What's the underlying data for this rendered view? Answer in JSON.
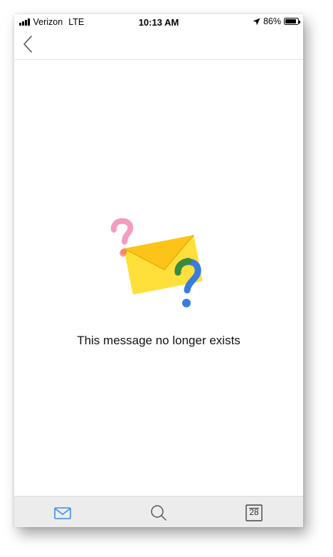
{
  "status_bar": {
    "carrier": "Verizon",
    "network": "LTE",
    "time": "10:13 AM",
    "battery_percent": "86%",
    "battery_level": 0.86,
    "icons": [
      "signal-bars-icon",
      "location-arrow-icon",
      "battery-icon"
    ]
  },
  "nav": {
    "back_icon": "chevron-left-icon"
  },
  "empty_state": {
    "illustration": "envelope-with-question-marks",
    "message": "This message no longer exists"
  },
  "tab_bar": {
    "tabs": [
      {
        "icon": "mail-icon",
        "active": true
      },
      {
        "icon": "search-icon",
        "active": false
      },
      {
        "icon": "calendar-icon",
        "active": false,
        "day": "28"
      }
    ]
  },
  "colors": {
    "accent": "#3c8ee6",
    "envelope_yellow": "#ffdc3a",
    "question_pink": "#f49bc1",
    "question_blue": "#3a7be0",
    "question_green": "#3b8a3e"
  }
}
